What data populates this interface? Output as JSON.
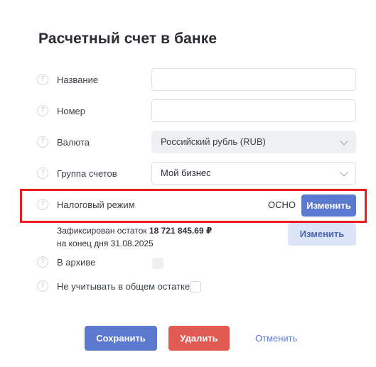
{
  "dialog": {
    "title": "Расчетный счет в банке"
  },
  "fields": {
    "name": {
      "label": "Название",
      "value": ""
    },
    "number": {
      "label": "Номер",
      "value": ""
    },
    "currency": {
      "label": "Валюта",
      "value": "Российский рубль (RUB)"
    },
    "account_group": {
      "label": "Группа счетов",
      "value": "Мой бизнес"
    },
    "tax_regime": {
      "label": "Налоговый режим",
      "value": "ОСНО",
      "button": "Изменить"
    }
  },
  "balance_note": {
    "prefix": "Зафиксирован остаток",
    "amount": "18 721 845.69 ₽",
    "line2": "на конец дня 31.08.2025",
    "button": "Изменить"
  },
  "options": {
    "archive_label": "В архиве",
    "exclude_label": "Не учитывать в общем остатке"
  },
  "footer": {
    "save": "Сохранить",
    "delete": "Удалить",
    "cancel": "Отменить"
  },
  "help_glyph": "?",
  "colors": {
    "accent": "#5b79cf",
    "danger": "#e05a52",
    "highlight": "#ee1c1c"
  }
}
